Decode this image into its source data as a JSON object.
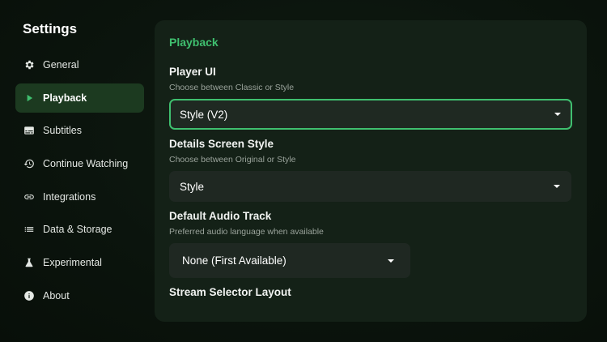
{
  "app": {
    "title": "Settings"
  },
  "sidebar": {
    "items": [
      {
        "label": "General",
        "icon": "gear-icon",
        "active": false
      },
      {
        "label": "Playback",
        "icon": "play-icon",
        "active": true
      },
      {
        "label": "Subtitles",
        "icon": "subtitles-icon",
        "active": false
      },
      {
        "label": "Continue Watching",
        "icon": "history-icon",
        "active": false
      },
      {
        "label": "Integrations",
        "icon": "link-icon",
        "active": false
      },
      {
        "label": "Data & Storage",
        "icon": "list-icon",
        "active": false
      },
      {
        "label": "Experimental",
        "icon": "flask-icon",
        "active": false
      },
      {
        "label": "About",
        "icon": "info-icon",
        "active": false
      }
    ]
  },
  "main": {
    "section_title": "Playback",
    "settings": [
      {
        "title": "Player UI",
        "description": "Choose between Classic or Style",
        "value": "Style (V2)"
      },
      {
        "title": "Details Screen Style",
        "description": "Choose between Original or Style",
        "value": "Style"
      },
      {
        "title": "Default Audio Track",
        "description": "Preferred audio language when available",
        "value": "None (First Available)"
      },
      {
        "title": "Stream Selector Layout"
      }
    ]
  },
  "colors": {
    "accent": "#3fbf6f",
    "active_bg": "#1c3a20",
    "panel_bg": "#142117"
  }
}
